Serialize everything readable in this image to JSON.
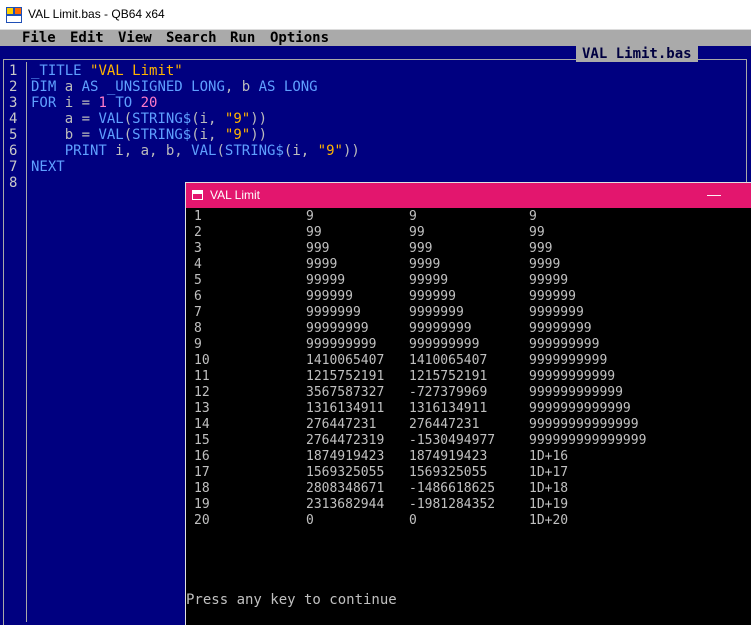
{
  "window": {
    "title": "VAL Limit.bas - QB64 x64"
  },
  "menu": {
    "items": [
      "File",
      "Edit",
      "View",
      "Search",
      "Run",
      "Options"
    ]
  },
  "editor": {
    "file_tab": "VAL Limit.bas",
    "line_numbers": [
      "1",
      "2",
      "3",
      "4",
      "5",
      "6",
      "7",
      "8"
    ],
    "lines": [
      [
        "_TITLE",
        " ",
        "\"VAL Limit\""
      ],
      [
        "DIM",
        " a ",
        "AS _UNSIGNED LONG",
        ", b ",
        "AS LONG"
      ],
      [
        "FOR",
        " i = ",
        "1",
        " ",
        "TO",
        " ",
        "20"
      ],
      [
        "    a = ",
        "VAL",
        "(",
        "STRING$",
        "(i, ",
        "\"9\"",
        "))"
      ],
      [
        "    b = ",
        "VAL",
        "(",
        "STRING$",
        "(i, ",
        "\"9\"",
        "))"
      ],
      [
        "    ",
        "PRINT",
        " i, a, b, ",
        "VAL",
        "(",
        "STRING$",
        "(i, ",
        "\"9\"",
        "))"
      ],
      [
        "NEXT"
      ],
      [
        ""
      ]
    ]
  },
  "output": {
    "title": "VAL Limit",
    "minimize": "—",
    "rows": [
      [
        "1",
        "9",
        "9",
        "9"
      ],
      [
        "2",
        "99",
        "99",
        "99"
      ],
      [
        "3",
        "999",
        "999",
        "999"
      ],
      [
        "4",
        "9999",
        "9999",
        "9999"
      ],
      [
        "5",
        "99999",
        "99999",
        "99999"
      ],
      [
        "6",
        "999999",
        "999999",
        "999999"
      ],
      [
        "7",
        "9999999",
        "9999999",
        "9999999"
      ],
      [
        "8",
        "99999999",
        "99999999",
        "99999999"
      ],
      [
        "9",
        "999999999",
        "999999999",
        "999999999"
      ],
      [
        "10",
        "1410065407",
        "1410065407",
        "9999999999"
      ],
      [
        "11",
        "1215752191",
        "1215752191",
        "99999999999"
      ],
      [
        "12",
        "3567587327",
        "-727379969",
        "999999999999"
      ],
      [
        "13",
        "1316134911",
        "1316134911",
        "9999999999999"
      ],
      [
        "14",
        "276447231",
        "276447231",
        "99999999999999"
      ],
      [
        "15",
        "2764472319",
        "-1530494977",
        "999999999999999"
      ],
      [
        "16",
        "1874919423",
        "1874919423",
        "1D+16"
      ],
      [
        "17",
        "1569325055",
        "1569325055",
        "1D+17"
      ],
      [
        "18",
        "2808348671",
        "-1486618625",
        "1D+18"
      ],
      [
        "19",
        "2313682944",
        "-1981284352",
        "1D+19"
      ],
      [
        "20",
        "0",
        "0",
        "1D+20"
      ]
    ],
    "footer": "Press any key to continue"
  }
}
